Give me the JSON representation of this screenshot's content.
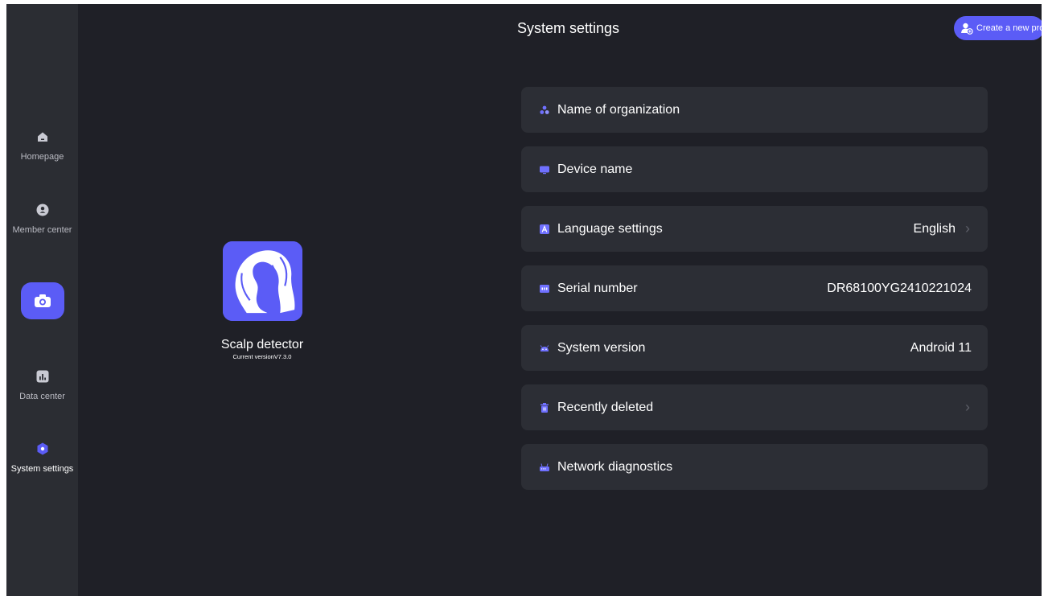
{
  "sidebar": {
    "items": [
      {
        "label": "Homepage",
        "icon": "home-icon"
      },
      {
        "label": "Member center",
        "icon": "user-icon"
      },
      {
        "label": "Data center",
        "icon": "chart-icon"
      },
      {
        "label": "System settings",
        "icon": "settings-icon"
      }
    ],
    "capture_icon": "camera-icon"
  },
  "header": {
    "title": "System settings",
    "create_profile_label": "Create a new profile"
  },
  "app_info": {
    "name": "Scalp detector",
    "version": "Current versionV7.3.0"
  },
  "settings": [
    {
      "label": "Name of organization",
      "value": "",
      "icon": "organization-icon"
    },
    {
      "label": "Device name",
      "value": "",
      "icon": "device-icon"
    },
    {
      "label": "Language settings",
      "value": "English",
      "icon": "language-icon",
      "arrow": true
    },
    {
      "label": "Serial number",
      "value": "DR68100YG2410221024",
      "icon": "serial-icon"
    },
    {
      "label": "System version",
      "value": "Android 11",
      "icon": "android-icon"
    },
    {
      "label": "Recently deleted",
      "value": "",
      "icon": "trash-icon",
      "arrow": true
    },
    {
      "label": "Network diagnostics",
      "value": "",
      "icon": "network-icon"
    }
  ],
  "colors": {
    "accent": "#5b5cf6",
    "background": "#1f2027",
    "sidebar": "#2b2d33",
    "card": "#2c2e35"
  }
}
